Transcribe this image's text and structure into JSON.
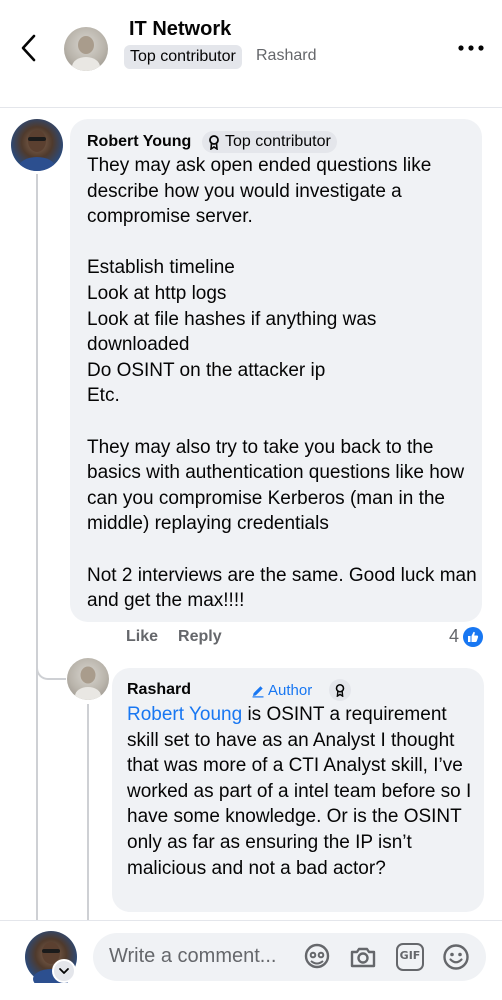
{
  "header": {
    "group_name": "IT Network",
    "badge": "Top contributor",
    "author": "Rashard"
  },
  "comments": [
    {
      "author": "Robert Young",
      "badge": "Top contributor",
      "text": "They may ask open ended questions like describe how you would investigate a compromise server.\n\nEstablish timeline\nLook at http logs\nLook at file hashes if anything was downloaded\nDo OSINT on the attacker ip\nEtc.\n\nThey may also try to take you back to the basics with authentication questions like how can you compromise Kerberos (man in the middle) replaying credentials\n\nNot 2 interviews are the same. Good luck man and get the max!!!!",
      "actions": {
        "like": "Like",
        "reply": "Reply"
      },
      "like_count": "4"
    },
    {
      "author": "Rashard",
      "role": "Author",
      "mention": "Robert Young",
      "text": " is OSINT a requirement skill set to have as an Analyst I thought that was more of a CTI Analyst skill, I’ve worked as part of a intel team before so I have some knowledge. Or is the OSINT only as far as ensuring the IP isn’t malicious and not a bad actor?"
    }
  ],
  "composer": {
    "placeholder": "Write a comment...",
    "gif_label": "GIF"
  },
  "colors": {
    "accent": "#1877f2",
    "bubble": "#f0f2f5",
    "secondary_text": "#65676b"
  },
  "icons": [
    "back-arrow-icon",
    "more-icon",
    "top-contributor-icon",
    "pencil-icon",
    "like-thumb-icon",
    "chevron-down-icon",
    "avatar-frame-icon",
    "camera-icon",
    "gif-icon",
    "emoji-icon"
  ]
}
